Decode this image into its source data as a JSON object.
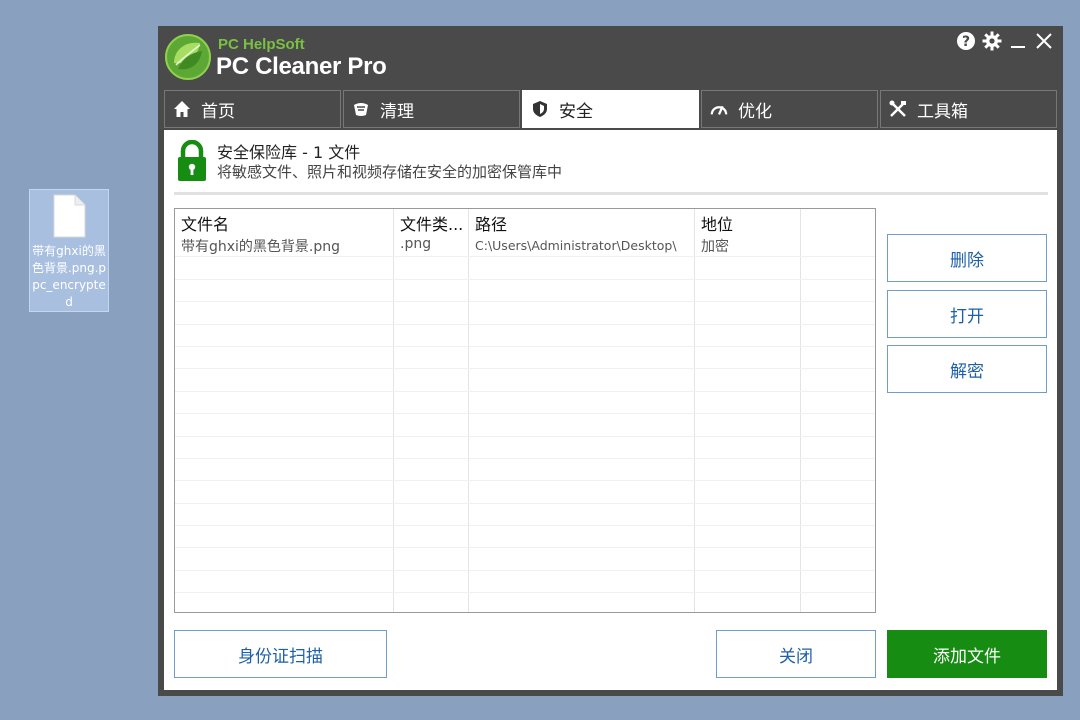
{
  "desktop": {
    "file_label": "带有ghxi的黑色背景.png.ppc_encrypted"
  },
  "app": {
    "brand_top": "PC HelpSoft",
    "brand_name": "PC Cleaner Pro",
    "colors": {
      "accent_green": "#178c13",
      "link_blue": "#1d5fa8",
      "titlebar": "#4a4a4a"
    }
  },
  "title_controls": [
    {
      "icon": "help-icon"
    },
    {
      "icon": "gear-icon"
    },
    {
      "icon": "minimize-icon"
    },
    {
      "icon": "close-icon"
    }
  ],
  "tabs": [
    {
      "label": "首页",
      "icon": "home-icon"
    },
    {
      "label": "清理",
      "icon": "broom-icon"
    },
    {
      "label": "安全",
      "icon": "shield-icon",
      "active": true
    },
    {
      "label": "优化",
      "icon": "speedometer-icon"
    },
    {
      "label": "工具箱",
      "icon": "tools-icon"
    }
  ],
  "vault": {
    "title": "安全保险库 - 1 文件",
    "subtitle": "将敏感文件、照片和视频存储在安全的加密保管库中"
  },
  "table": {
    "columns": [
      "文件名",
      "文件类...",
      "路径",
      "地位",
      ""
    ],
    "rows": [
      [
        "带有ghxi的黑色背景.png",
        ".png",
        "C:\\Users\\Administrator\\Desktop\\",
        "加密",
        ""
      ]
    ]
  },
  "side_buttons": {
    "delete": "删除",
    "open": "打开",
    "decrypt": "解密"
  },
  "bottom_buttons": {
    "id_scan": "身份证扫描",
    "close": "关闭",
    "add_file": "添加文件"
  }
}
